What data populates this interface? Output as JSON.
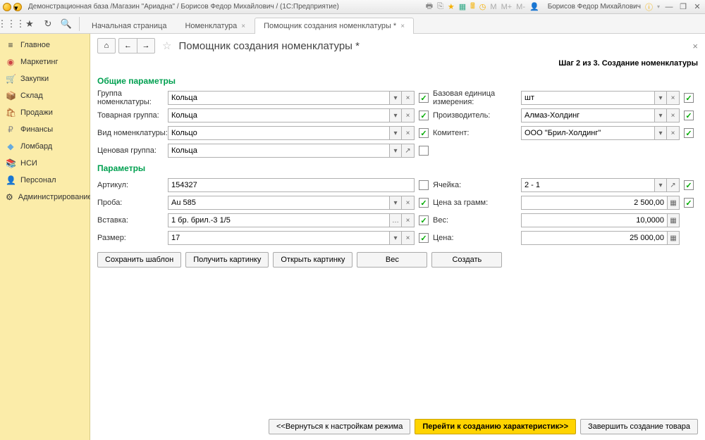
{
  "titlebar": {
    "title": "Демонстрационная база /Магазин \"Ариадна\" / Борисов Федор Михайлович / (1С:Предприятие)",
    "user": "Борисов Федор Михайлович"
  },
  "tabs": {
    "t1": "Начальная страница",
    "t2": "Номенклатура",
    "t3": "Помощник создания номенклатуры *"
  },
  "sidebar": {
    "items": [
      {
        "icon": "≡",
        "label": "Главное"
      },
      {
        "icon": "◉",
        "label": "Маркетинг"
      },
      {
        "icon": "🛒",
        "label": "Закупки"
      },
      {
        "icon": "📦",
        "label": "Склад"
      },
      {
        "icon": "🛍",
        "label": "Продажи"
      },
      {
        "icon": "₽",
        "label": "Финансы"
      },
      {
        "icon": "◆",
        "label": "Ломбард"
      },
      {
        "icon": "📚",
        "label": "НСИ"
      },
      {
        "icon": "👤",
        "label": "Персонал"
      },
      {
        "icon": "⚙",
        "label": "Администрирование"
      }
    ]
  },
  "page": {
    "title": "Помощник создания номенклатуры *",
    "step": "Шаг 2 из 3. Создание номенклатуры"
  },
  "sections": {
    "s1": "Общие параметры",
    "s2": "Параметры"
  },
  "labels": {
    "group": "Группа номенклатуры:",
    "tgroup": "Товарная группа:",
    "vid": "Вид номенклатуры:",
    "price_group": "Ценовая группа:",
    "base_unit": "Базовая единица измерения:",
    "manufacturer": "Производитель:",
    "komitent": "Комитент:",
    "article": "Артикул:",
    "cell": "Ячейка:",
    "proba": "Проба:",
    "price_gram": "Цена за грамм:",
    "insert": "Вставка:",
    "weight": "Вес:",
    "size": "Размер:",
    "price": "Цена:"
  },
  "values": {
    "group": "Кольца",
    "tgroup": "Кольца",
    "vid": "Кольцо",
    "price_group": "Кольца",
    "base_unit": "шт",
    "manufacturer": "Алмаз-Холдинг",
    "komitent": "ООО \"Брил-Холдинг\"",
    "article": "154327",
    "cell": "2 - 1",
    "proba": "Au 585",
    "price_gram": "2 500,00",
    "insert": "1 бр. брил.-3 1/5",
    "weight": "10,0000",
    "size": "17",
    "price": "25 000,00"
  },
  "buttons": {
    "save_template": "Сохранить шаблон",
    "get_image": "Получить картинку",
    "open_image": "Открыть картинку",
    "weight": "Вес",
    "create": "Создать",
    "back": "<<Вернуться к настройкам режима",
    "next": "Перейти к созданию характеристик>>",
    "finish": "Завершить создание товара"
  }
}
